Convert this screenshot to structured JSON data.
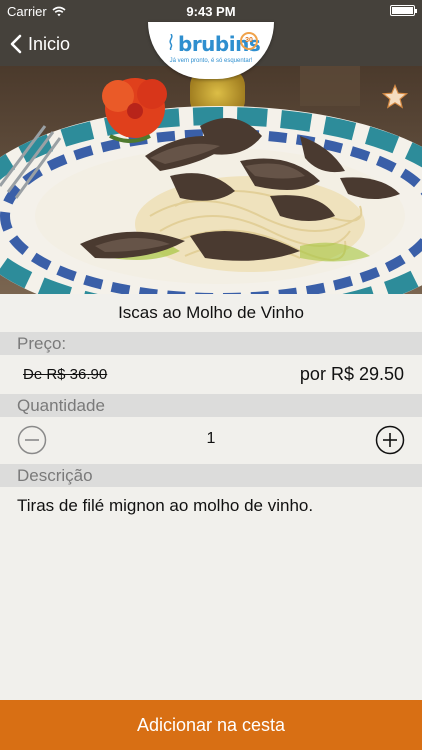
{
  "status_bar": {
    "carrier": "Carrier",
    "time": "9:43 PM"
  },
  "nav": {
    "back_label": "Inicio"
  },
  "logo": {
    "brand": "brubins",
    "tagline": "Já vem pronto, é só esquentar!",
    "badge": "30 anos"
  },
  "product": {
    "name": "Iscas ao Molho de Vinho",
    "price_label": "Preço:",
    "old_price": "De R$ 36.90",
    "new_price": "por R$ 29.50",
    "quantity_label": "Quantidade",
    "quantity": "1",
    "description_label": "Descrição",
    "description": "Tiras de filé mignon ao molho de vinho."
  },
  "actions": {
    "add_to_cart": "Adicionar na cesta"
  },
  "colors": {
    "nav": "#45413b",
    "accent": "#d86f14",
    "brand": "#2f8fcf",
    "section": "#dcdcdb"
  },
  "icons": [
    "wifi-icon",
    "battery-icon",
    "chevron-left-icon",
    "star-icon",
    "minus-circle-icon",
    "plus-circle-icon"
  ]
}
